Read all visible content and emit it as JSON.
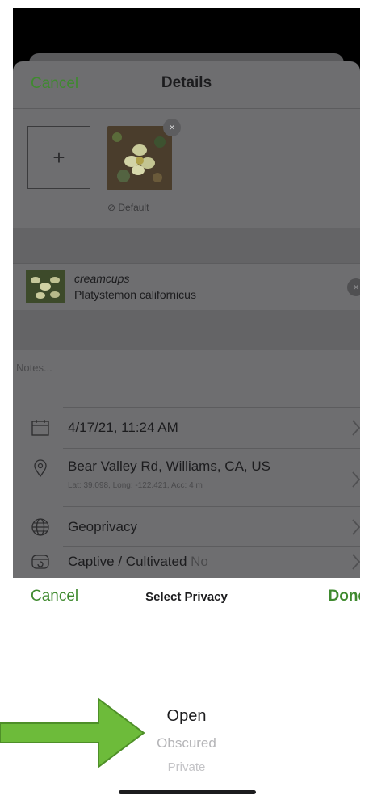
{
  "details": {
    "nav": {
      "cancel_label": "Cancel",
      "title": "Details"
    },
    "add_photo_label": "+",
    "photo": {
      "remove_label": "×",
      "default_label": "⊘ Default"
    },
    "species": {
      "common_name": "creamcups",
      "scientific_name": "Platystemon californicus",
      "remove_label": "×"
    },
    "notes_placeholder": "Notes...",
    "rows": {
      "date": {
        "text": "4/17/21, 11:24 AM",
        "icon": "calendar-icon"
      },
      "location": {
        "text": "Bear Valley Rd, Williams, CA, US",
        "sub": "Lat: 39.098, Long: -122.421, Acc: 4 m",
        "icon": "map-pin-icon"
      },
      "geoprivacy": {
        "text": "Geoprivacy",
        "icon": "globe-icon"
      },
      "captive": {
        "text": "Captive / Cultivated",
        "value": "No",
        "icon": "captive-icon"
      }
    }
  },
  "picker": {
    "cancel_label": "Cancel",
    "title": "Select Privacy",
    "done_label": "Done",
    "options": [
      "Open",
      "Obscured",
      "Private"
    ],
    "selected": "Open"
  },
  "colors": {
    "accent_green": "#3f8a2f",
    "overlay_gray": "#6e6e70",
    "arrow_green": "#6dbb3a"
  }
}
